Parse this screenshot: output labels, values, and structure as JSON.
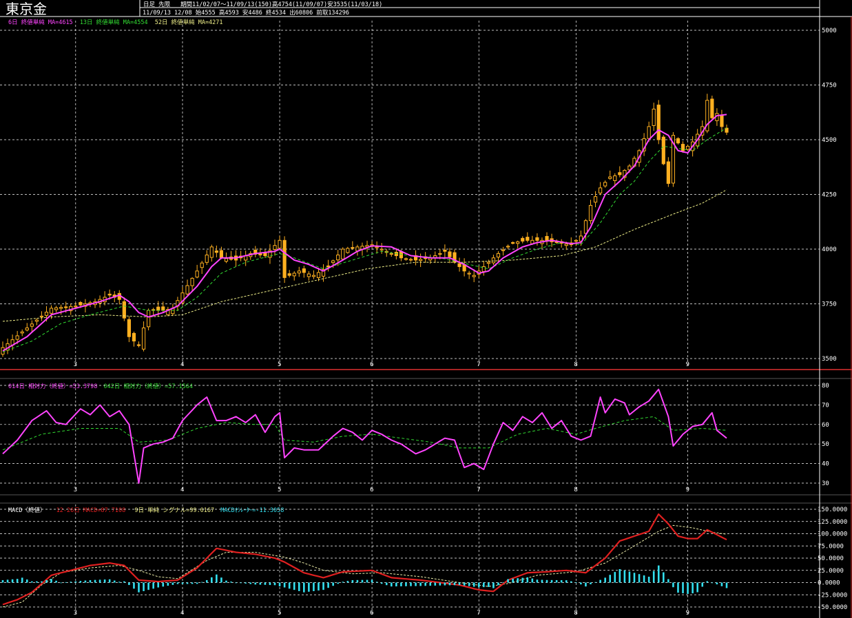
{
  "header": {
    "title": "東京金",
    "mode": "日足 先限",
    "period_line": "期間11/02/07〜11/09/13(150)高4754(11/09/07)安3535(11/03/18)",
    "last_line": "11/09/13 12/08 始4555 高4593 安4486 終4534 出60806 前取134296"
  },
  "colors": {
    "background": "#000000",
    "grid": "#ffffff",
    "candle_body": "#ffb020",
    "ma_short": "#ff44ff",
    "ma_mid": "#33dd33",
    "ma_long": "#eeee88",
    "macd": "#e02020",
    "signal": "#eeeeaa",
    "osc": "#33e0f0",
    "frame": "#e03030"
  },
  "chart_data": [
    {
      "type": "candlestick",
      "legend": [
        {
          "text": "6日 終値単純 MA=4615",
          "color": "#ff44ff"
        },
        {
          "text": "13日 終値単純 MA=4554",
          "color": "#33dd33"
        },
        {
          "text": "52日 終値単純 MA=4271",
          "color": "#eeee88"
        }
      ],
      "y_ticks": [
        3500,
        3750,
        4000,
        4250,
        4500,
        4750,
        5000
      ],
      "ylim": [
        3500,
        5000
      ],
      "x_ticks": [
        "3",
        "4",
        "5",
        "6",
        "7",
        "8",
        "9"
      ],
      "x_tick_index": [
        15,
        37,
        57,
        76,
        98,
        118,
        141
      ],
      "n": 150,
      "close_anchors": [
        [
          0,
          3550
        ],
        [
          5,
          3640
        ],
        [
          10,
          3730
        ],
        [
          15,
          3740
        ],
        [
          19,
          3760
        ],
        [
          22,
          3790
        ],
        [
          24,
          3770
        ],
        [
          26,
          3600
        ],
        [
          28,
          3560
        ],
        [
          30,
          3720
        ],
        [
          33,
          3720
        ],
        [
          35,
          3730
        ],
        [
          37,
          3800
        ],
        [
          40,
          3900
        ],
        [
          43,
          4010
        ],
        [
          45,
          3960
        ],
        [
          48,
          3950
        ],
        [
          51,
          3980
        ],
        [
          54,
          3970
        ],
        [
          57,
          4040
        ],
        [
          58,
          3870
        ],
        [
          61,
          3900
        ],
        [
          64,
          3880
        ],
        [
          67,
          3920
        ],
        [
          70,
          4000
        ],
        [
          73,
          4010
        ],
        [
          76,
          4020
        ],
        [
          79,
          3990
        ],
        [
          82,
          3960
        ],
        [
          85,
          3950
        ],
        [
          88,
          3960
        ],
        [
          91,
          3990
        ],
        [
          93,
          3940
        ],
        [
          95,
          3900
        ],
        [
          97,
          3880
        ],
        [
          99,
          3920
        ],
        [
          102,
          3980
        ],
        [
          105,
          4030
        ],
        [
          108,
          4040
        ],
        [
          111,
          4040
        ],
        [
          114,
          4030
        ],
        [
          117,
          4020
        ],
        [
          119,
          4060
        ],
        [
          121,
          4200
        ],
        [
          123,
          4280
        ],
        [
          125,
          4330
        ],
        [
          127,
          4340
        ],
        [
          129,
          4380
        ],
        [
          131,
          4450
        ],
        [
          133,
          4560
        ],
        [
          134,
          4640
        ],
        [
          135,
          4500
        ],
        [
          136,
          4390
        ],
        [
          137,
          4300
        ],
        [
          138,
          4520
        ],
        [
          140,
          4450
        ],
        [
          142,
          4490
        ],
        [
          144,
          4560
        ],
        [
          145,
          4680
        ],
        [
          146,
          4600
        ],
        [
          147,
          4620
        ],
        [
          148,
          4560
        ],
        [
          149,
          4534
        ]
      ],
      "ma6_anchors": [
        [
          0,
          3535
        ],
        [
          5,
          3600
        ],
        [
          10,
          3700
        ],
        [
          15,
          3730
        ],
        [
          20,
          3760
        ],
        [
          24,
          3790
        ],
        [
          26,
          3760
        ],
        [
          28,
          3710
        ],
        [
          30,
          3690
        ],
        [
          33,
          3710
        ],
        [
          36,
          3740
        ],
        [
          40,
          3830
        ],
        [
          43,
          3920
        ],
        [
          45,
          3960
        ],
        [
          48,
          3960
        ],
        [
          52,
          3980
        ],
        [
          56,
          3990
        ],
        [
          57,
          4000
        ],
        [
          60,
          3950
        ],
        [
          63,
          3930
        ],
        [
          66,
          3900
        ],
        [
          70,
          3950
        ],
        [
          73,
          3990
        ],
        [
          76,
          4015
        ],
        [
          80,
          4010
        ],
        [
          84,
          3970
        ],
        [
          88,
          3960
        ],
        [
          92,
          3960
        ],
        [
          95,
          3930
        ],
        [
          98,
          3890
        ],
        [
          100,
          3900
        ],
        [
          103,
          3960
        ],
        [
          107,
          4010
        ],
        [
          110,
          4030
        ],
        [
          113,
          4040
        ],
        [
          117,
          4025
        ],
        [
          119,
          4030
        ],
        [
          121,
          4100
        ],
        [
          124,
          4250
        ],
        [
          127,
          4310
        ],
        [
          130,
          4380
        ],
        [
          133,
          4500
        ],
        [
          135,
          4545
        ],
        [
          137,
          4520
        ],
        [
          139,
          4450
        ],
        [
          141,
          4440
        ],
        [
          143,
          4500
        ],
        [
          145,
          4570
        ],
        [
          147,
          4610
        ],
        [
          149,
          4615
        ]
      ],
      "ma13_anchors": [
        [
          0,
          3530
        ],
        [
          6,
          3580
        ],
        [
          12,
          3660
        ],
        [
          18,
          3700
        ],
        [
          25,
          3740
        ],
        [
          30,
          3720
        ],
        [
          36,
          3720
        ],
        [
          40,
          3780
        ],
        [
          45,
          3890
        ],
        [
          50,
          3940
        ],
        [
          57,
          3980
        ],
        [
          60,
          3960
        ],
        [
          66,
          3910
        ],
        [
          72,
          3950
        ],
        [
          78,
          3990
        ],
        [
          84,
          3970
        ],
        [
          90,
          3960
        ],
        [
          96,
          3930
        ],
        [
          100,
          3910
        ],
        [
          105,
          3960
        ],
        [
          110,
          4000
        ],
        [
          115,
          4030
        ],
        [
          119,
          4020
        ],
        [
          123,
          4120
        ],
        [
          127,
          4250
        ],
        [
          130,
          4310
        ],
        [
          133,
          4400
        ],
        [
          136,
          4470
        ],
        [
          139,
          4460
        ],
        [
          142,
          4450
        ],
        [
          145,
          4500
        ],
        [
          149,
          4554
        ]
      ],
      "ma52_anchors": [
        [
          0,
          3670
        ],
        [
          10,
          3690
        ],
        [
          20,
          3700
        ],
        [
          30,
          3690
        ],
        [
          37,
          3700
        ],
        [
          45,
          3760
        ],
        [
          55,
          3810
        ],
        [
          65,
          3860
        ],
        [
          75,
          3910
        ],
        [
          85,
          3940
        ],
        [
          95,
          3940
        ],
        [
          105,
          3950
        ],
        [
          115,
          3970
        ],
        [
          122,
          4010
        ],
        [
          130,
          4090
        ],
        [
          138,
          4160
        ],
        [
          144,
          4210
        ],
        [
          149,
          4271
        ]
      ]
    },
    {
      "type": "line",
      "legend": [
        {
          "text": "014日 相対力（終値）=53.3798",
          "color": "#ff44ff"
        },
        {
          "text": "042日 相対力（終値）=57.1564",
          "color": "#33dd33"
        }
      ],
      "y_ticks": [
        30,
        40,
        50,
        60,
        70,
        80
      ],
      "ylim": [
        30,
        80
      ],
      "rsi14_anchors": [
        [
          0,
          45
        ],
        [
          3,
          52
        ],
        [
          6,
          62
        ],
        [
          9,
          67
        ],
        [
          11,
          61
        ],
        [
          13,
          60
        ],
        [
          16,
          68
        ],
        [
          18,
          65
        ],
        [
          20,
          70
        ],
        [
          22,
          64
        ],
        [
          24,
          67
        ],
        [
          26,
          60
        ],
        [
          28,
          30
        ],
        [
          29,
          48
        ],
        [
          31,
          50
        ],
        [
          33,
          51
        ],
        [
          35,
          53
        ],
        [
          37,
          62
        ],
        [
          40,
          70
        ],
        [
          42,
          74
        ],
        [
          44,
          62
        ],
        [
          46,
          62
        ],
        [
          48,
          64
        ],
        [
          50,
          61
        ],
        [
          52,
          65
        ],
        [
          54,
          56
        ],
        [
          56,
          64
        ],
        [
          57,
          66
        ],
        [
          58,
          43
        ],
        [
          60,
          48
        ],
        [
          62,
          47
        ],
        [
          65,
          47
        ],
        [
          68,
          54
        ],
        [
          70,
          58
        ],
        [
          72,
          56
        ],
        [
          74,
          52
        ],
        [
          76,
          57
        ],
        [
          78,
          55
        ],
        [
          80,
          52
        ],
        [
          82,
          50
        ],
        [
          85,
          45
        ],
        [
          87,
          47
        ],
        [
          89,
          50
        ],
        [
          91,
          53
        ],
        [
          93,
          52
        ],
        [
          95,
          38
        ],
        [
          97,
          40
        ],
        [
          99,
          37
        ],
        [
          101,
          50
        ],
        [
          103,
          61
        ],
        [
          105,
          57
        ],
        [
          107,
          64
        ],
        [
          109,
          61
        ],
        [
          111,
          66
        ],
        [
          113,
          58
        ],
        [
          115,
          62
        ],
        [
          117,
          54
        ],
        [
          119,
          52
        ],
        [
          121,
          54
        ],
        [
          123,
          74
        ],
        [
          124,
          66
        ],
        [
          126,
          73
        ],
        [
          128,
          71
        ],
        [
          129,
          65
        ],
        [
          131,
          69
        ],
        [
          133,
          72
        ],
        [
          135,
          78
        ],
        [
          137,
          64
        ],
        [
          138,
          49
        ],
        [
          140,
          55
        ],
        [
          142,
          59
        ],
        [
          144,
          60
        ],
        [
          146,
          66
        ],
        [
          147,
          57
        ],
        [
          149,
          53
        ]
      ],
      "rsi42_anchors": [
        [
          0,
          47
        ],
        [
          8,
          55
        ],
        [
          16,
          58
        ],
        [
          24,
          58
        ],
        [
          28,
          51
        ],
        [
          34,
          52
        ],
        [
          40,
          58
        ],
        [
          46,
          61
        ],
        [
          52,
          60
        ],
        [
          56,
          60
        ],
        [
          58,
          52
        ],
        [
          64,
          51
        ],
        [
          70,
          54
        ],
        [
          76,
          55
        ],
        [
          82,
          53
        ],
        [
          88,
          51
        ],
        [
          94,
          48
        ],
        [
          100,
          48
        ],
        [
          106,
          55
        ],
        [
          112,
          58
        ],
        [
          118,
          55
        ],
        [
          122,
          58
        ],
        [
          128,
          62
        ],
        [
          134,
          64
        ],
        [
          138,
          57
        ],
        [
          144,
          58
        ],
        [
          149,
          57
        ]
      ]
    },
    {
      "type": "line",
      "legend": [
        {
          "text": "MACD（終値）",
          "color": "#ffffff"
        },
        {
          "text": "12-26日 MACD=87.7108",
          "color": "#e02020"
        },
        {
          "text": "9日 単純 シグナル=99.0167",
          "color": "#eeee88"
        },
        {
          "text": "MACDｵｼﾚｰﾀｰ=-11.3058",
          "color": "#33e0f0"
        }
      ],
      "y_ticks": [
        "150.0000",
        "125.0000",
        "100.0000",
        "75.0000",
        "50.0000",
        "25.0000",
        "0.0000",
        "-25.0000",
        "-50.0000"
      ],
      "ylim": [
        -50,
        150
      ],
      "macd_anchors": [
        [
          0,
          -45
        ],
        [
          3,
          -35
        ],
        [
          6,
          -20
        ],
        [
          10,
          15
        ],
        [
          14,
          25
        ],
        [
          18,
          35
        ],
        [
          22,
          40
        ],
        [
          25,
          35
        ],
        [
          28,
          5
        ],
        [
          32,
          2
        ],
        [
          36,
          5
        ],
        [
          40,
          30
        ],
        [
          44,
          70
        ],
        [
          48,
          62
        ],
        [
          52,
          58
        ],
        [
          56,
          50
        ],
        [
          58,
          42
        ],
        [
          62,
          20
        ],
        [
          66,
          10
        ],
        [
          70,
          22
        ],
        [
          76,
          25
        ],
        [
          80,
          10
        ],
        [
          86,
          5
        ],
        [
          90,
          0
        ],
        [
          94,
          -5
        ],
        [
          98,
          -15
        ],
        [
          101,
          -18
        ],
        [
          104,
          5
        ],
        [
          108,
          20
        ],
        [
          112,
          22
        ],
        [
          116,
          25
        ],
        [
          120,
          20
        ],
        [
          124,
          50
        ],
        [
          127,
          85
        ],
        [
          130,
          95
        ],
        [
          133,
          105
        ],
        [
          135,
          140
        ],
        [
          137,
          120
        ],
        [
          139,
          95
        ],
        [
          141,
          90
        ],
        [
          143,
          90
        ],
        [
          145,
          108
        ],
        [
          147,
          98
        ],
        [
          149,
          87.7
        ]
      ],
      "signal_anchors": [
        [
          0,
          -50
        ],
        [
          4,
          -40
        ],
        [
          8,
          -5
        ],
        [
          12,
          20
        ],
        [
          18,
          30
        ],
        [
          24,
          35
        ],
        [
          28,
          25
        ],
        [
          32,
          12
        ],
        [
          36,
          8
        ],
        [
          42,
          45
        ],
        [
          46,
          62
        ],
        [
          52,
          62
        ],
        [
          58,
          52
        ],
        [
          62,
          40
        ],
        [
          66,
          25
        ],
        [
          72,
          18
        ],
        [
          78,
          20
        ],
        [
          86,
          12
        ],
        [
          94,
          0
        ],
        [
          100,
          -8
        ],
        [
          104,
          -2
        ],
        [
          110,
          15
        ],
        [
          118,
          22
        ],
        [
          124,
          40
        ],
        [
          130,
          75
        ],
        [
          135,
          105
        ],
        [
          138,
          117
        ],
        [
          142,
          112
        ],
        [
          146,
          103
        ],
        [
          149,
          99
        ]
      ]
    }
  ]
}
